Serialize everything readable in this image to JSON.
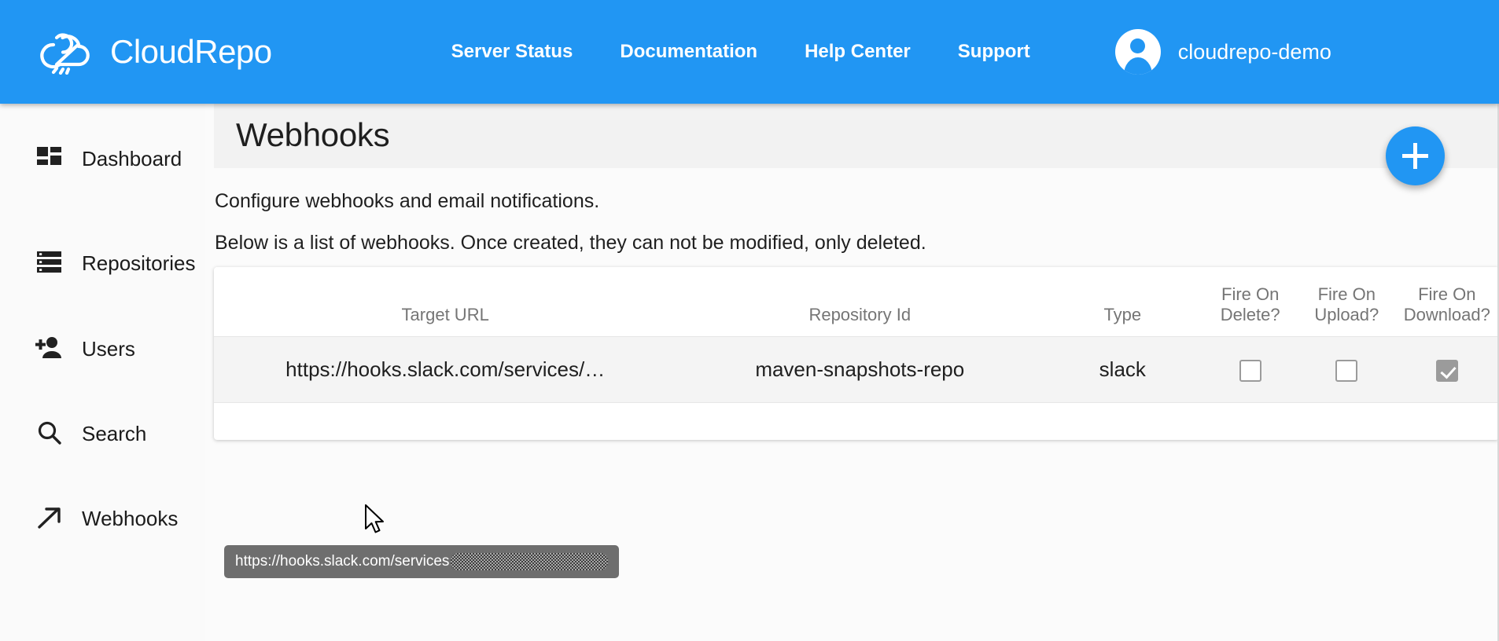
{
  "header": {
    "brand_name": "CloudRepo",
    "brand_logo_icon": "cloud-repo-logo-icon",
    "nav_links": [
      {
        "label": "Server Status",
        "name": "nav-link-server-status"
      },
      {
        "label": "Documentation",
        "name": "nav-link-documentation"
      },
      {
        "label": "Help Center",
        "name": "nav-link-help-center"
      },
      {
        "label": "Support",
        "name": "nav-link-support"
      }
    ],
    "user": {
      "name": "cloudrepo-demo",
      "avatar_icon": "user-avatar-icon"
    },
    "background_color": "#2196f3"
  },
  "sidebar": {
    "items": [
      {
        "label": "Dashboard",
        "icon": "dashboard-grid-icon"
      },
      {
        "label": "Repositories",
        "icon": "server-stack-icon"
      },
      {
        "label": "Users",
        "icon": "person-add-icon"
      },
      {
        "label": "Search",
        "icon": "magnifier-icon"
      },
      {
        "label": "Webhooks",
        "icon": "arrow-up-right-icon"
      }
    ]
  },
  "page": {
    "title": "Webhooks",
    "add_button_label": "+",
    "add_button_icon": "plus-icon",
    "paragraph_1": "Configure webhooks and email notifications.",
    "paragraph_2": "Below is a list of webhooks. Once created, they can not be modified, only deleted.",
    "accent_color": "#2196f3"
  },
  "table": {
    "columns": [
      "Target URL",
      "Repository Id",
      "Type",
      "Fire On Delete?",
      "Fire On Upload?",
      "Fire On Download?"
    ],
    "rows": [
      {
        "target_url": "https://hooks.slack.com/services/…",
        "repository_id": "maven-snapshots-repo",
        "type": "slack",
        "fire_on_delete": false,
        "fire_on_upload": false,
        "fire_on_download": true
      }
    ]
  },
  "tooltip": {
    "text": "https://hooks.slack.com/services",
    "redacted": true
  }
}
